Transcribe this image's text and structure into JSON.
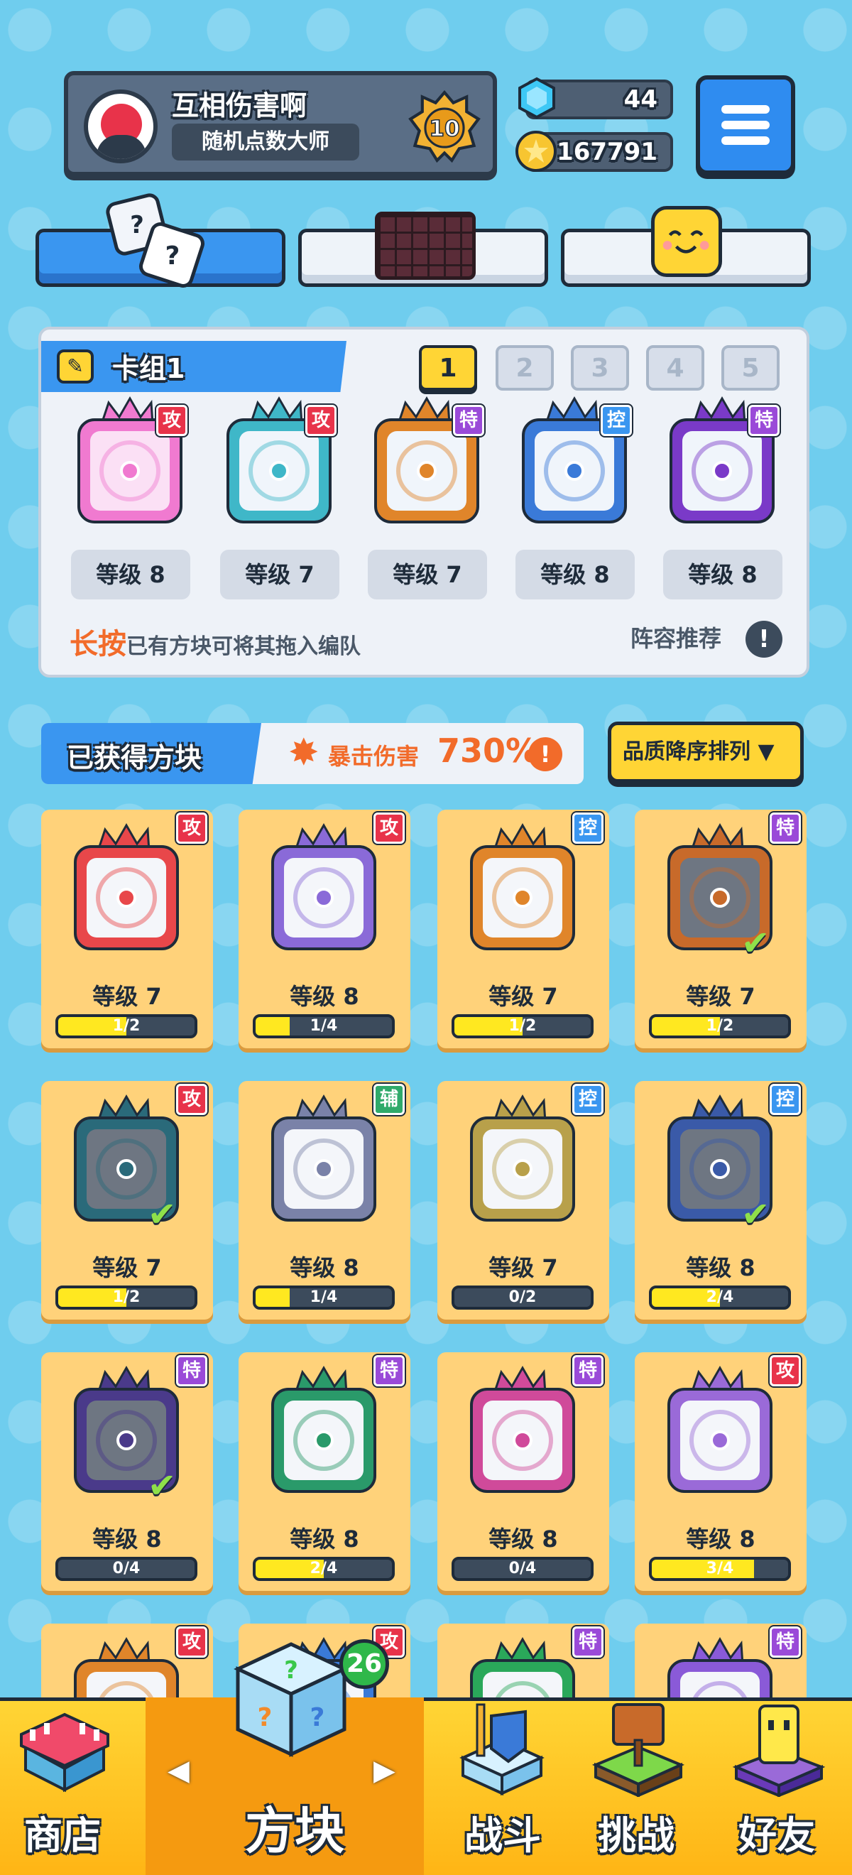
{
  "player": {
    "name": "互相伤害啊",
    "title": "随机点数大师",
    "rank": "10"
  },
  "currency": {
    "gems": "44",
    "coins": "167791"
  },
  "deck": {
    "title": "卡组1",
    "pages": [
      "1",
      "2",
      "3",
      "4",
      "5"
    ],
    "active_page": "1",
    "slots": [
      {
        "tag": "攻",
        "level": "等级 8",
        "color": "#e8334a",
        "ring": "#f07ad0"
      },
      {
        "tag": "攻",
        "level": "等级 7",
        "color": "#e8334a",
        "ring": "#3fb7c8"
      },
      {
        "tag": "特",
        "level": "等级 7",
        "color": "#9a4ad8",
        "ring": "#e0852a"
      },
      {
        "tag": "控",
        "level": "等级 8",
        "color": "#3a96f0",
        "ring": "#3a7ad8"
      },
      {
        "tag": "特",
        "level": "等级 8",
        "color": "#9a4ad8",
        "ring": "#7a3ac8"
      }
    ],
    "hint_bold": "长按",
    "hint": "已有方块可将其拖入编队",
    "recommend": "阵容推荐"
  },
  "collection": {
    "title": "已获得方块",
    "crit_label": "暴击伤害",
    "crit_value": "730%",
    "sort_label": "品质降序排列 ▼",
    "cards": [
      {
        "tag": "攻",
        "tag_color": "#e8334a",
        "ring": "#e8474a",
        "level": "等级 7",
        "progress": "1/2",
        "fill": 0.5,
        "checked": false
      },
      {
        "tag": "攻",
        "tag_color": "#e8334a",
        "ring": "#8a6ad8",
        "level": "等级 8",
        "progress": "1/4",
        "fill": 0.25,
        "checked": false
      },
      {
        "tag": "控",
        "tag_color": "#3a96f0",
        "ring": "#e0852a",
        "level": "等级 7",
        "progress": "1/2",
        "fill": 0.5,
        "checked": false
      },
      {
        "tag": "特",
        "tag_color": "#9a4ad8",
        "ring": "#c86a2a",
        "level": "等级 7",
        "progress": "1/2",
        "fill": 0.5,
        "checked": true
      },
      {
        "tag": "攻",
        "tag_color": "#e8334a",
        "ring": "#2a6a7a",
        "level": "等级 7",
        "progress": "1/2",
        "fill": 0.5,
        "checked": true
      },
      {
        "tag": "辅",
        "tag_color": "#2faa6a",
        "ring": "#7a82a8",
        "level": "等级 8",
        "progress": "1/4",
        "fill": 0.25,
        "checked": false
      },
      {
        "tag": "控",
        "tag_color": "#3a96f0",
        "ring": "#b8a04a",
        "level": "等级 7",
        "progress": "0/2",
        "fill": 0,
        "checked": false
      },
      {
        "tag": "控",
        "tag_color": "#3a96f0",
        "ring": "#3a5aa8",
        "level": "等级 8",
        "progress": "2/4",
        "fill": 0.5,
        "checked": true
      },
      {
        "tag": "特",
        "tag_color": "#9a4ad8",
        "ring": "#4a3a8a",
        "level": "等级 8",
        "progress": "0/4",
        "fill": 0,
        "checked": true
      },
      {
        "tag": "特",
        "tag_color": "#9a4ad8",
        "ring": "#2a9a6a",
        "level": "等级 8",
        "progress": "2/4",
        "fill": 0.5,
        "checked": false
      },
      {
        "tag": "特",
        "tag_color": "#9a4ad8",
        "ring": "#d04a9a",
        "level": "等级 8",
        "progress": "0/4",
        "fill": 0,
        "checked": false
      },
      {
        "tag": "攻",
        "tag_color": "#e8334a",
        "ring": "#9a6ad8",
        "level": "等级 8",
        "progress": "3/4",
        "fill": 0.75,
        "checked": false
      },
      {
        "tag": "攻",
        "tag_color": "#e8334a",
        "ring": "#e0852a",
        "level": "",
        "progress": "",
        "fill": 0,
        "checked": false
      },
      {
        "tag": "攻",
        "tag_color": "#e8334a",
        "ring": "#3a7ad8",
        "level": "",
        "progress": "",
        "fill": 0,
        "checked": false
      },
      {
        "tag": "特",
        "tag_color": "#9a4ad8",
        "ring": "#2aa85a",
        "level": "",
        "progress": "",
        "fill": 0,
        "checked": false
      },
      {
        "tag": "特",
        "tag_color": "#9a4ad8",
        "ring": "#8a5ad8",
        "level": "",
        "progress": "",
        "fill": 0,
        "checked": false
      }
    ]
  },
  "nav": {
    "shop": "商店",
    "blocks": "方块",
    "battle": "战斗",
    "challenge": "挑战",
    "friends": "好友",
    "badge": "26",
    "active": "blocks"
  }
}
